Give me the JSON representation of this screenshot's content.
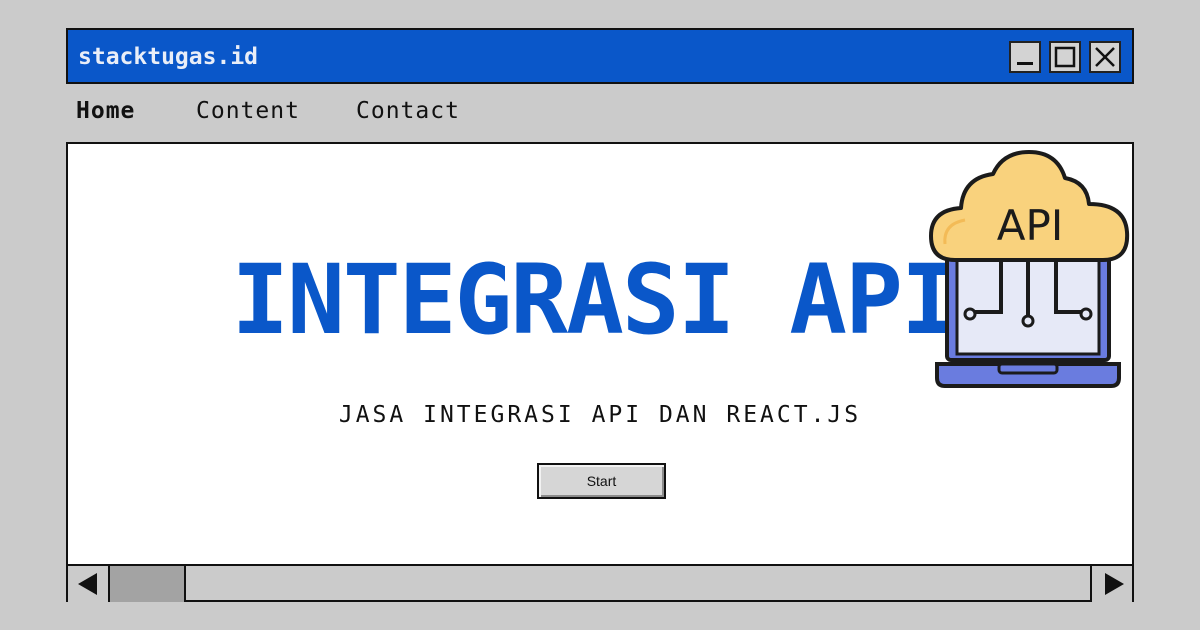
{
  "window": {
    "title": "stacktugas.id",
    "controls": [
      "minimize-icon",
      "maximize-icon",
      "close-icon"
    ]
  },
  "menu": {
    "items": [
      {
        "label": "Home",
        "active": true
      },
      {
        "label": "Content",
        "active": false
      },
      {
        "label": "Contact",
        "active": false
      }
    ]
  },
  "main": {
    "headline": "INTEGRASI API",
    "subtitle": "JASA INTEGRASI API DAN REACT.JS",
    "start_label": "Start",
    "illustration": {
      "icon": "cloud-api-laptop-icon",
      "cloud_text": "API"
    }
  },
  "scrollbar": {
    "left_icon": "triangle-left-icon",
    "right_icon": "triangle-right-icon"
  },
  "colors": {
    "accent": "#0a57c9",
    "background": "#cbcbcb",
    "panel": "#ffffff",
    "cloud": "#f9d27d",
    "laptop": "#6a7cdf"
  }
}
